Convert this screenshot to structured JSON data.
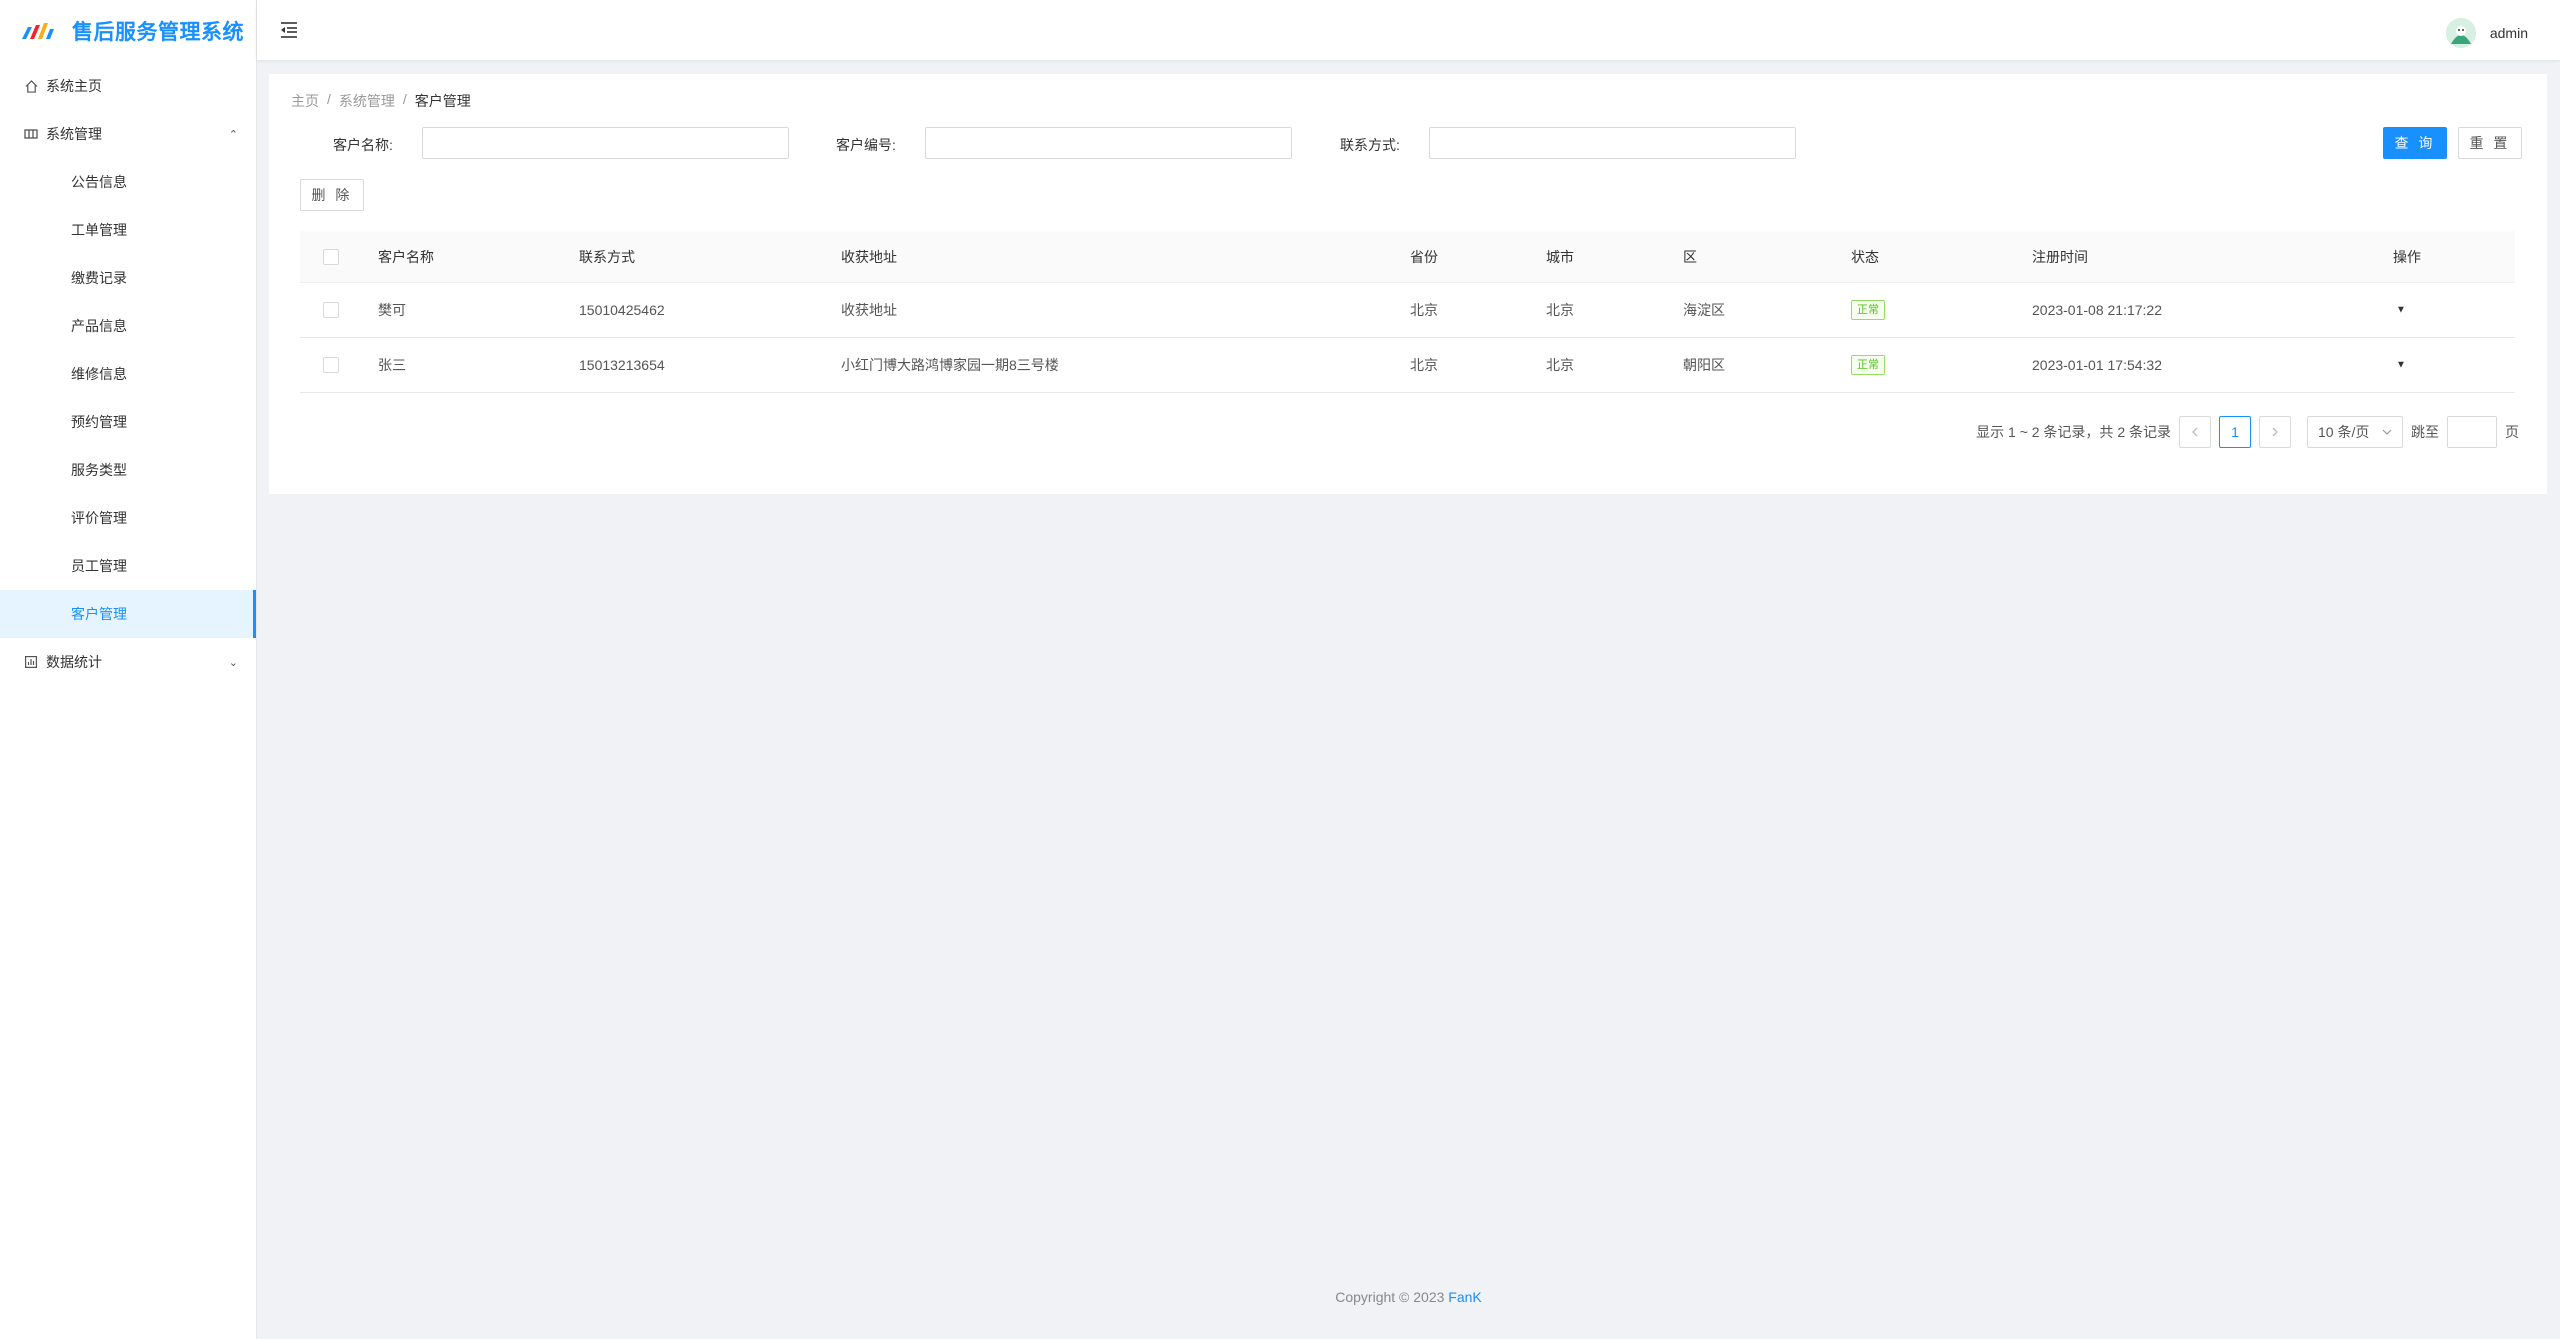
{
  "app": {
    "title": "售后服务管理系统"
  },
  "sidebar": {
    "home": "系统主页",
    "system_group": "系统管理",
    "system_items": [
      "公告信息",
      "工单管理",
      "缴费记录",
      "产品信息",
      "维修信息",
      "预约管理",
      "服务类型",
      "评价管理",
      "员工管理",
      "客户管理"
    ],
    "active_item": "客户管理",
    "stats_group": "数据统计"
  },
  "header": {
    "username": "admin"
  },
  "breadcrumb": {
    "home": "主页",
    "parent": "系统管理",
    "current": "客户管理",
    "separator": "/"
  },
  "filters": {
    "name_label": "客户名称:",
    "code_label": "客户编号:",
    "contact_label": "联系方式:",
    "name_value": "",
    "code_value": "",
    "contact_value": "",
    "search_btn": "查 询",
    "reset_btn": "重 置",
    "delete_btn": "删 除"
  },
  "table": {
    "columns": [
      "客户名称",
      "联系方式",
      "收获地址",
      "省份",
      "城市",
      "区",
      "状态",
      "注册时间",
      "操作"
    ],
    "rows": [
      {
        "name": "樊可",
        "phone": "15010425462",
        "address": "收获地址",
        "province": "北京",
        "city": "北京",
        "district": "海淀区",
        "status": "正常",
        "time": "2023-01-08 21:17:22"
      },
      {
        "name": "张三",
        "phone": "15013213654",
        "address": "小红门博大路鸿博家园一期8三号楼",
        "province": "北京",
        "city": "北京",
        "district": "朝阳区",
        "status": "正常",
        "time": "2023-01-01 17:54:32"
      }
    ]
  },
  "pagination": {
    "summary": "显示 1 ~ 2 条记录，共 2 条记录",
    "current_page": "1",
    "page_size": "10 条/页",
    "jump_label": "跳至",
    "page_suffix": "页"
  },
  "footer": {
    "copyright": "Copyright © 2023",
    "brand": "FanK"
  },
  "colors": {
    "primary": "#1890ff",
    "success": "#52c41a",
    "background": "#f0f2f5"
  }
}
